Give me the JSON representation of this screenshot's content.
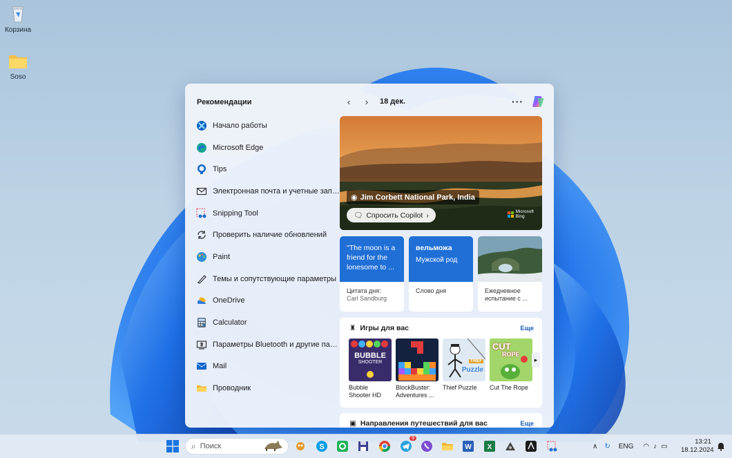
{
  "desktop": {
    "icons": [
      {
        "label": "Корзина",
        "icon": "recycle-bin-icon"
      },
      {
        "label": "Soso",
        "icon": "folder-icon"
      }
    ]
  },
  "widgets": {
    "recommendations_title": "Рекомендации",
    "date": "18 дек.",
    "more_label": "···",
    "apps": [
      {
        "label": "Начало работы",
        "icon": "get-started-icon"
      },
      {
        "label": "Microsoft Edge",
        "icon": "edge-icon"
      },
      {
        "label": "Tips",
        "icon": "tips-icon"
      },
      {
        "label": "Электронная почта и учетные записи",
        "icon": "mail-accounts-icon"
      },
      {
        "label": "Snipping Tool",
        "icon": "snipping-tool-icon"
      },
      {
        "label": "Проверить наличие обновлений",
        "icon": "update-icon"
      },
      {
        "label": "Paint",
        "icon": "paint-icon"
      },
      {
        "label": "Темы и сопутствующие параметры",
        "icon": "themes-icon"
      },
      {
        "label": "OneDrive",
        "icon": "onedrive-icon"
      },
      {
        "label": "Calculator",
        "icon": "calculator-icon"
      },
      {
        "label": "Параметры Bluetooth и другие пара...",
        "icon": "bluetooth-settings-icon"
      },
      {
        "label": "Mail",
        "icon": "mail-icon"
      },
      {
        "label": "Проводник",
        "icon": "file-explorer-icon"
      }
    ],
    "hero": {
      "location": "Jim Corbett National Park, India",
      "ask_copilot": "Спросить Copilot",
      "brand_line1": "Microsoft",
      "brand_line2": "Bing"
    },
    "cards": [
      {
        "top_text": "\"The moon is a friend for the lonesome to ...",
        "label": "Цитата дня:",
        "sub": "Carl Sandburg",
        "color": "#1f6fd6"
      },
      {
        "top_title": "вельможа",
        "top_text": "Мужской род",
        "label": "Слово дня",
        "sub": "",
        "color": "#1f6fd6"
      },
      {
        "label": "Ежедневное испытание с ...",
        "sub": "",
        "color": "#4a6a5a"
      }
    ],
    "games": {
      "title": "Игры для вас",
      "more": "Еще",
      "items": [
        {
          "name": "Bubble Shooter HD",
          "art_text_1": "BUBBLE",
          "art_text_2": "SHOOTER"
        },
        {
          "name": "BlockBuster: Adventures ..."
        },
        {
          "name": "Thief Puzzle",
          "art_text_1": "THIEF",
          "art_text_2": "Puzzle"
        },
        {
          "name": "Cut The Rope",
          "art_text_1": "CUT",
          "art_text_2": "ROPE"
        }
      ]
    },
    "travel": {
      "title": "Направления путешествий для вас",
      "more": "Еще"
    }
  },
  "taskbar": {
    "search_placeholder": "Поиск",
    "language": "ENG",
    "time": "13:21",
    "date": "18.12.2024",
    "badge": "9"
  }
}
